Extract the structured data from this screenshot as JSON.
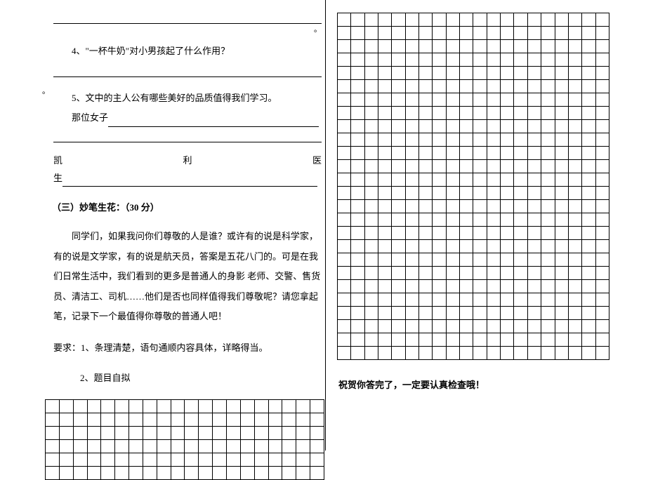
{
  "left": {
    "blank_top_marker": "。",
    "q4": "4、\"一杯牛奶\"对小男孩起了什么作用？",
    "q5": "5、文中的主人公有哪些美好的品质值得我们学习。",
    "q5_woman_label": "那位女子",
    "kaili_a": "凯",
    "kaili_b": "利",
    "kaili_c": "医",
    "kaili_d": "生",
    "section3": "（三）妙笔生花：（30 分）",
    "essay_para": "同学们，如果我问你们尊敬的人是谁？或许有的说是科学家，有的说是文学家，有的说是航天员，答案是五花八门的。可是在我们日常生活中，我们看到的更多是普通人的身影 老师、交警、售货员、清洁工、司机……他们是否也同样值得我们尊敬呢？请您拿起笔，记录下一个最值得你尊敬的普通人吧！",
    "req1": "要求：1、条理清楚，语句通顺内容具体，详略得当。",
    "req2": "2、题目自拟"
  },
  "right": {
    "congrats": "祝贺你答完了，一定要认真检查哦！"
  }
}
